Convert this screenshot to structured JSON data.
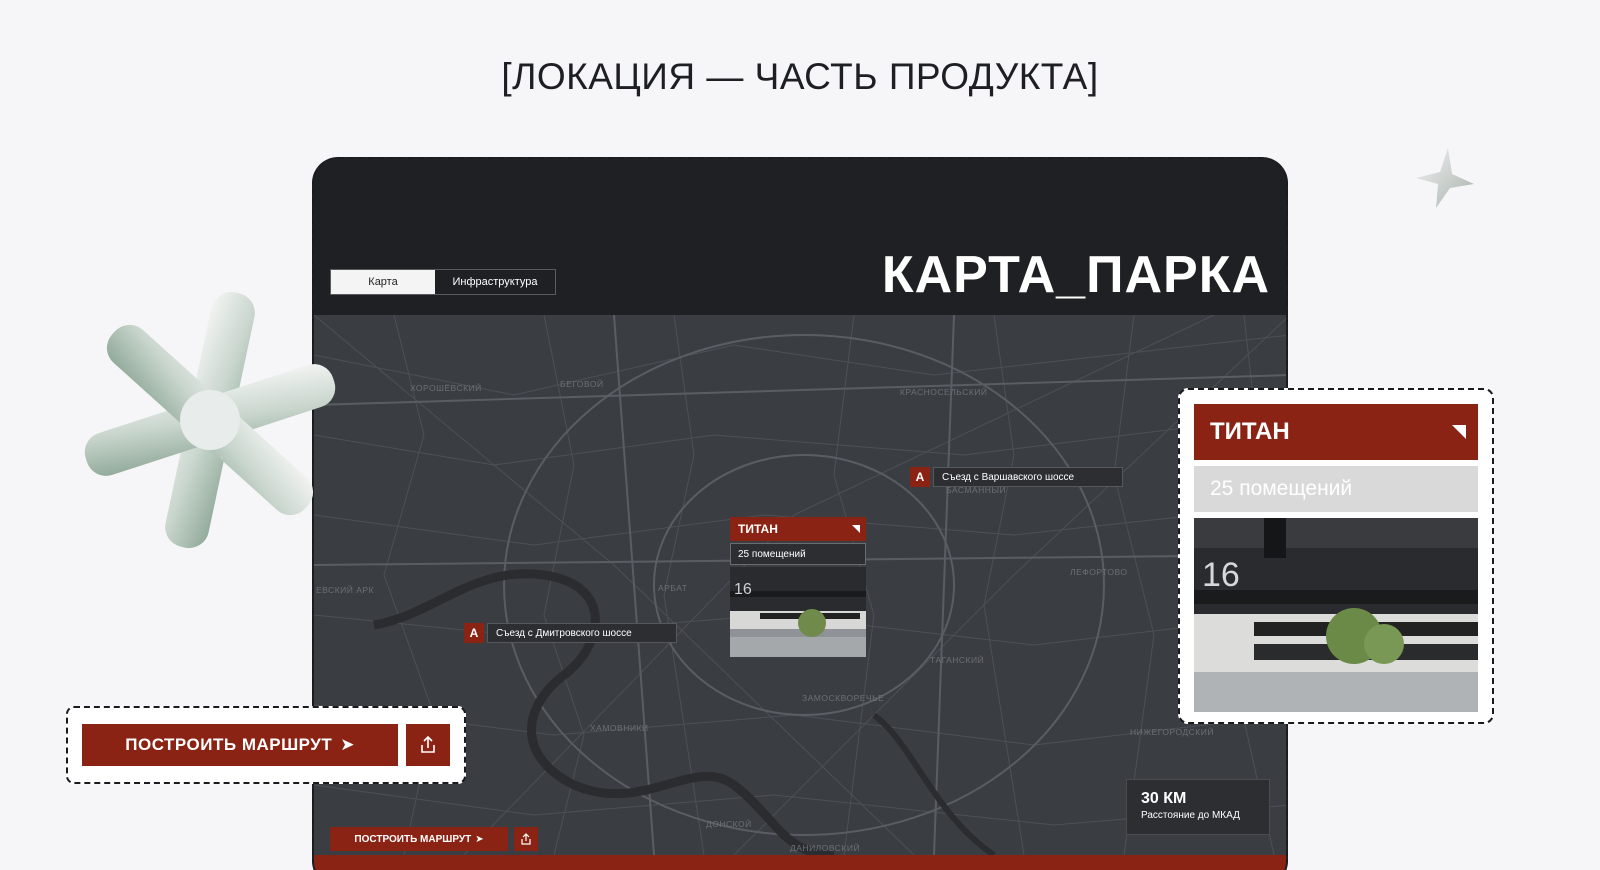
{
  "heading": "[ЛОКАЦИЯ — ЧАСТЬ ПРОДУКТА]",
  "map_screen": {
    "tabs": [
      {
        "label": "Карта",
        "active": true
      },
      {
        "label": "Инфраструктура",
        "active": false
      }
    ],
    "title": "КАРТА_ПАРКА",
    "districts": [
      "ХОРОШЁВСКИЙ",
      "БЕГОВОЙ",
      "КРАСНОСЕЛЬСКИЙ",
      "БАСМАННЫЙ",
      "ЛЕФОРТОВО",
      "ТАГАНСКИЙ",
      "ЗАМОСКВОРЕЧЬЕ",
      "ХАМОВНИКИ",
      "НИЖЕГОРОДСКИЙ",
      "ДОНСКОЙ",
      "ДАНИЛОВСКИЙ",
      "АРБАТ",
      "ЕВСКИЙ АРК"
    ],
    "exits": [
      {
        "icon": "highway-exit-icon",
        "label": "Съезд с Варшавского шоссе"
      },
      {
        "icon": "highway-exit-icon",
        "label": "Съезд с Дмитровского шоссе"
      }
    ],
    "pin": {
      "title": "ТИТАН",
      "rooms": "25 помещений",
      "building_number": "16"
    },
    "distance": {
      "value": "30 КМ",
      "caption": "Расстояние до МКАД"
    },
    "route_button": "ПОСТРОИТЬ МАРШРУТ"
  },
  "card_zoom": {
    "title": "ТИТАН",
    "rooms": "25 помещений",
    "building_number": "16"
  },
  "route_callout": {
    "label": "ПОСТРОИТЬ МАРШРУТ"
  },
  "colors": {
    "accent": "#8a2314",
    "map_background": "#3a3d42",
    "header_dark": "#1f2023",
    "page_background": "#f6f6f8"
  }
}
